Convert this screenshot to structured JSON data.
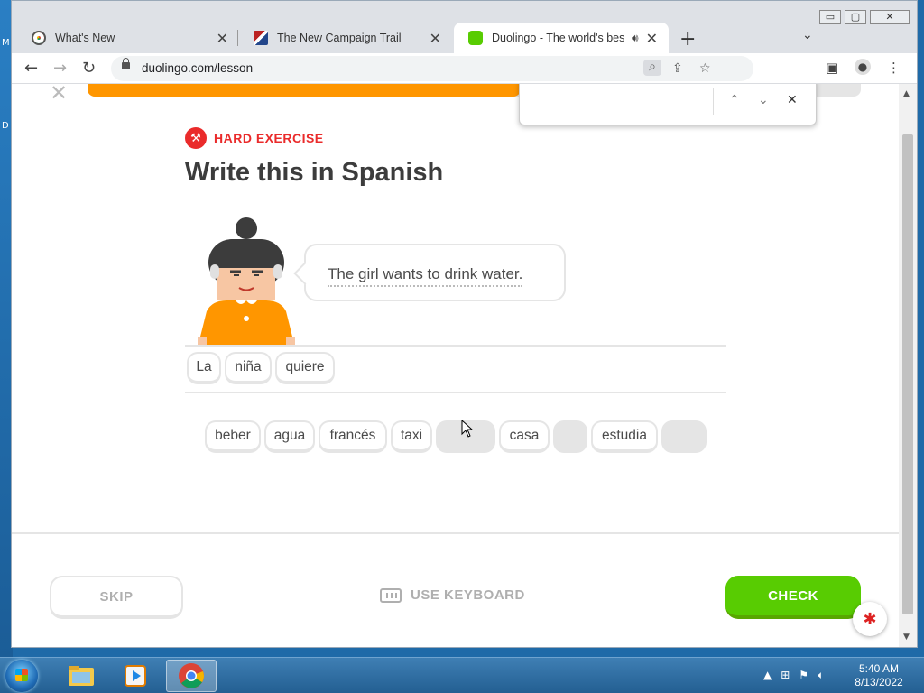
{
  "desktop": {
    "edge_letters": [
      "M",
      "D"
    ]
  },
  "browser": {
    "tabs": [
      {
        "label": "What's New",
        "icon": "chrome-icon"
      },
      {
        "label": "The New Campaign Trail",
        "icon": "flag-icon"
      },
      {
        "label": "Duolingo - The world's best",
        "icon": "duolingo-icon",
        "audio_icon": "speaker-icon"
      }
    ],
    "window_controls": {
      "minimize": "▭",
      "maximize": "▢",
      "close": "✕"
    },
    "new_tab": "+",
    "url": "duolingo.com/lesson"
  },
  "lesson": {
    "progress_fraction": 0.56,
    "close_symbol": "✕",
    "badge": "HARD EXERCISE",
    "title": "Write this in Spanish",
    "prompt": "The girl wants to drink water.",
    "answer_words": [
      "La",
      "niña",
      "quiere"
    ],
    "word_bank": [
      {
        "text": "beber",
        "used": false
      },
      {
        "text": "agua",
        "used": false
      },
      {
        "text": "francés",
        "used": false
      },
      {
        "text": "taxi",
        "used": false
      },
      {
        "text": "",
        "used": true
      },
      {
        "text": "casa",
        "used": false
      },
      {
        "text": "",
        "used": true
      },
      {
        "text": "estudia",
        "used": false
      },
      {
        "text": "",
        "used": true
      }
    ],
    "skip_label": "SKIP",
    "keyboard_label": "USE KEYBOARD",
    "check_label": "CHECK"
  },
  "colors": {
    "progress": "#ff9600",
    "hard_red": "#ea2b2b",
    "check_green": "#58cc02",
    "character_shirt": "#ff9600"
  },
  "taskbar": {
    "time": "5:40 AM",
    "date": "8/13/2022",
    "apps": [
      "explorer-icon",
      "media-player-icon",
      "chrome-icon"
    ]
  }
}
